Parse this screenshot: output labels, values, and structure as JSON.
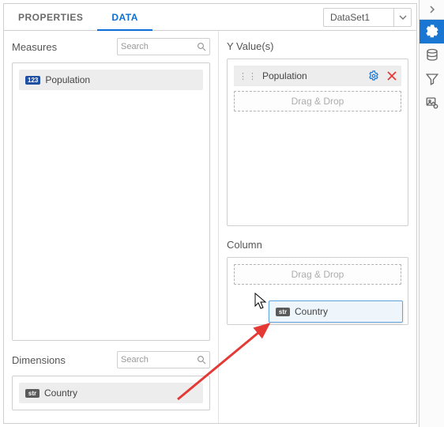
{
  "tabs": {
    "properties": "PROPERTIES",
    "data": "DATA"
  },
  "dataset": {
    "selected": "DataSet1"
  },
  "left": {
    "measures_title": "Measures",
    "dimensions_title": "Dimensions",
    "search_placeholder": "Search",
    "measure_badge": "123",
    "dimension_badge": "str",
    "measure_name": "Population",
    "dimension_name": "Country"
  },
  "right": {
    "yvalues_title": "Y Value(s)",
    "column_title": "Column",
    "drag_label": "Drag & Drop",
    "y_item": "Population"
  },
  "drag": {
    "badge": "str",
    "name": "Country"
  }
}
